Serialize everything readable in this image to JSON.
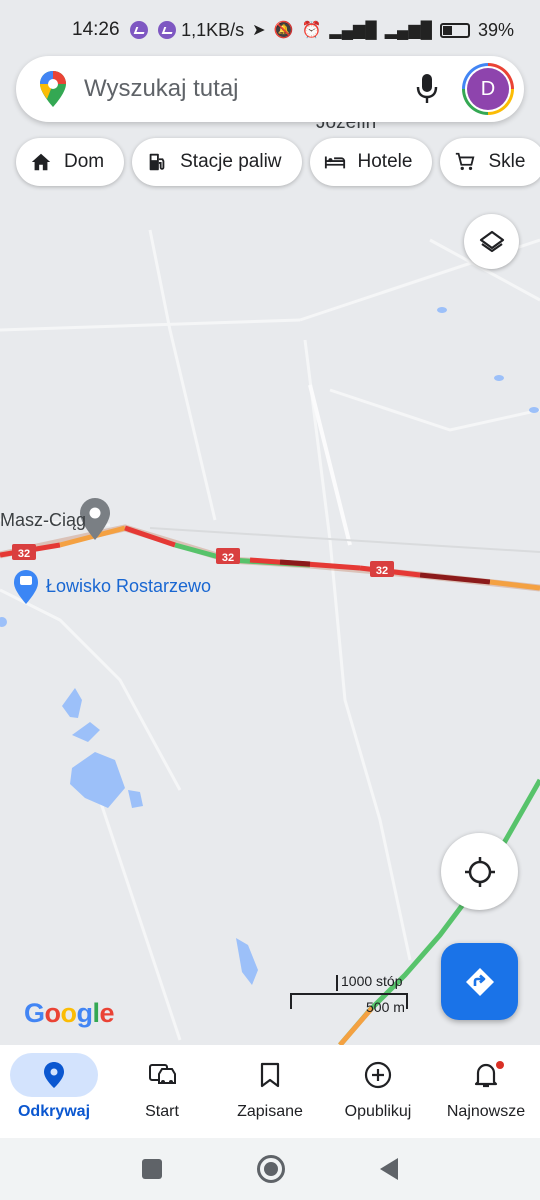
{
  "status_bar": {
    "time": "14:26",
    "speed": "1,1KB/s",
    "battery": "39%",
    "battery_level": 0.39
  },
  "search": {
    "placeholder": "Wyszukaj tutaj",
    "avatar_letter": "D"
  },
  "chips": [
    {
      "label": "Dom",
      "icon": "home-icon"
    },
    {
      "label": "Stacje paliw",
      "icon": "gas-station-icon"
    },
    {
      "label": "Hotele",
      "icon": "hotel-icon"
    },
    {
      "label": "Skle",
      "icon": "cart-icon"
    }
  ],
  "map": {
    "town": "Józefin",
    "place": "Masz-Ciąg",
    "poi": "Łowisko Rostarzewo",
    "road_number": "32",
    "scale_imperial": "1000 stóp",
    "scale_metric": "500 m",
    "logo": "Google"
  },
  "bottom_nav": [
    {
      "label": "Odkrywaj",
      "icon": "pin-icon",
      "active": true
    },
    {
      "label": "Start",
      "icon": "car-icon"
    },
    {
      "label": "Zapisane",
      "icon": "bookmark-icon"
    },
    {
      "label": "Opublikuj",
      "icon": "add-circle-icon"
    },
    {
      "label": "Najnowsze",
      "icon": "bell-icon"
    }
  ],
  "colors": {
    "accent": "#1a73e8",
    "traffic_red": "#e53935",
    "traffic_dark": "#8b1a1a",
    "traffic_orange": "#f4a142",
    "traffic_green": "#57c36b"
  }
}
